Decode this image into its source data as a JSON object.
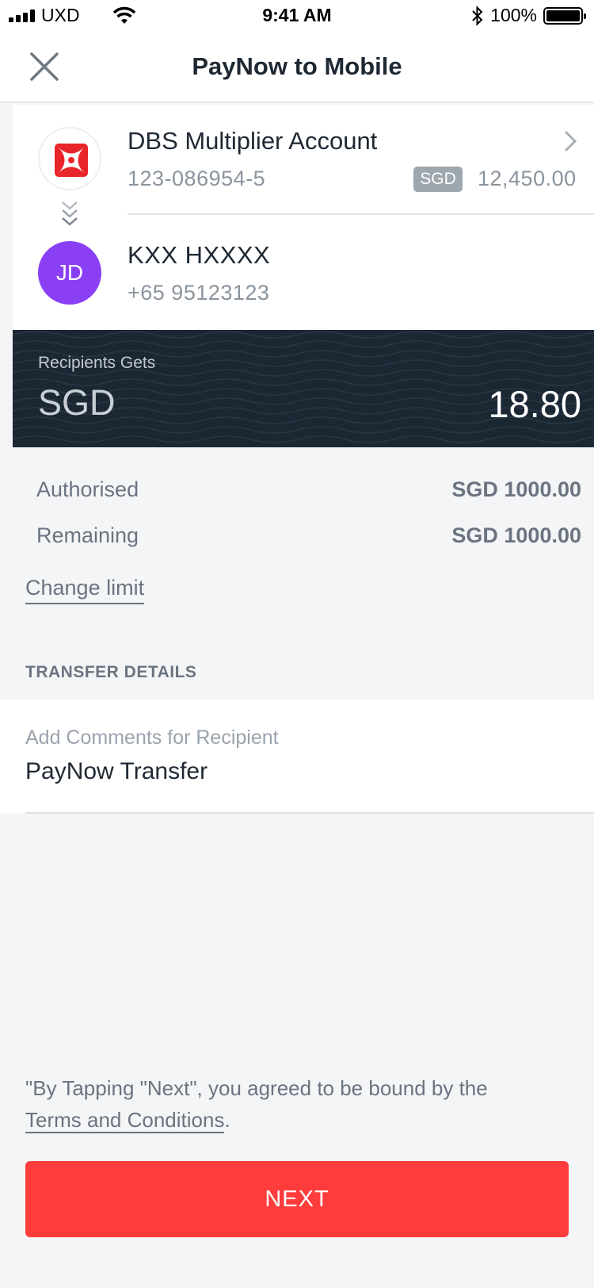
{
  "status_bar": {
    "carrier": "UXD",
    "time": "9:41 AM",
    "battery": "100%"
  },
  "header": {
    "title": "PayNow to Mobile",
    "close_icon": "close-icon"
  },
  "from_account": {
    "name": "DBS Multiplier Account",
    "number": "123-086954-5",
    "currency": "SGD",
    "balance": "12,450.00",
    "logo": "dbs-logo-icon"
  },
  "recipient": {
    "initials": "JD",
    "name": "KXX HXXXX",
    "phone": "+65 95123123",
    "avatar_color": "#8a3ff5"
  },
  "amount": {
    "label": "Recipients Gets",
    "currency": "SGD",
    "value": "18.80"
  },
  "limits": {
    "authorised_label": "Authorised",
    "authorised_value": "SGD 1000.00",
    "remaining_label": "Remaining",
    "remaining_value": "SGD 1000.00",
    "change_limit": "Change limit"
  },
  "transfer_details": {
    "section_title": "TRANSFER DETAILS",
    "comments_label": "Add Comments for Recipient",
    "comments_value": "PayNow Transfer"
  },
  "terms": {
    "text": "\"By Tapping \"Next\", you agreed to be bound by the",
    "link": "Terms and Conditions",
    "suffix": "."
  },
  "next_button": {
    "label": "NEXT",
    "color": "#ff3c3c"
  },
  "colors": {
    "panel_dark": "#1c2734",
    "text_primary": "#1e2833",
    "text_secondary": "#8a949e"
  }
}
